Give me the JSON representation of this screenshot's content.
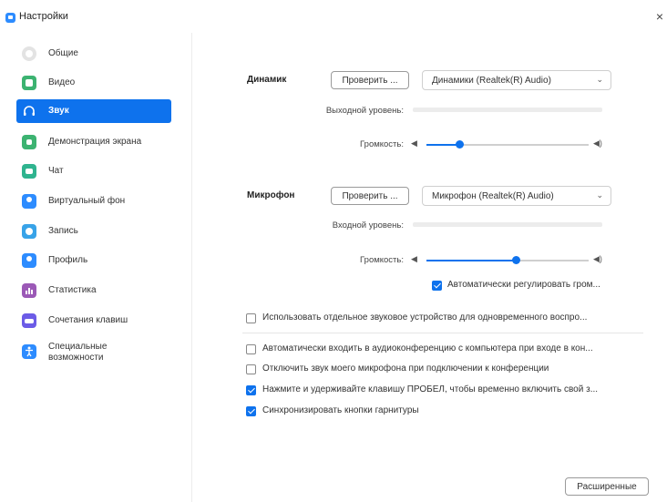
{
  "window": {
    "title": "Настройки",
    "close_glyph": "×"
  },
  "sidebar": {
    "items": [
      {
        "label": "Общие",
        "icon": "gear-icon",
        "color": "#cfcfcf"
      },
      {
        "label": "Видео",
        "icon": "video-icon",
        "color": "#3cb371"
      },
      {
        "label": "Звук",
        "icon": "headphones-icon",
        "color": "#0e72ed"
      },
      {
        "label": "Демонстрация экрана",
        "icon": "share-screen-icon",
        "color": "#3cb371"
      },
      {
        "label": "Чат",
        "icon": "chat-icon",
        "color": "#2fb48f"
      },
      {
        "label": "Виртуальный фон",
        "icon": "virtual-background-icon",
        "color": "#2d8cff"
      },
      {
        "label": "Запись",
        "icon": "record-icon",
        "color": "#38a3e8"
      },
      {
        "label": "Профиль",
        "icon": "profile-icon",
        "color": "#2d8cff"
      },
      {
        "label": "Статистика",
        "icon": "statistics-icon",
        "color": "#9b59b6"
      },
      {
        "label": "Сочетания клавиш",
        "icon": "keyboard-icon",
        "color": "#6c5ce7"
      },
      {
        "label": "Специальные возможности",
        "icon": "accessibility-icon",
        "color": "#2d8cff"
      }
    ],
    "active_index": 2
  },
  "speaker": {
    "label": "Динамик",
    "test_button": "Проверить ...",
    "device": "Динамики (Realtek(R) Audio)",
    "output_level_label": "Выходной уровень:",
    "volume_label": "Громкость:",
    "volume_percent": 20
  },
  "microphone": {
    "label": "Микрофон",
    "test_button": "Проверить ...",
    "device": "Микрофон (Realtek(R) Audio)",
    "input_level_label": "Входной уровень:",
    "volume_label": "Громкость:",
    "volume_percent": 55,
    "auto_adjust_label": "Автоматически регулировать гром...",
    "auto_adjust_checked": true
  },
  "options": [
    {
      "label": "Использовать отдельное звуковое устройство для одновременного воспро...",
      "checked": false
    },
    {
      "label": "Автоматически входить в аудиоконференцию с компьютера при входе в кон...",
      "checked": false
    },
    {
      "label": "Отключить звук моего микрофона при подключении к конференции",
      "checked": false
    },
    {
      "label": "Нажмите и удерживайте клавишу ПРОБЕЛ, чтобы временно включить свой з...",
      "checked": true
    },
    {
      "label": "Синхронизировать кнопки гарнитуры",
      "checked": true
    }
  ],
  "advanced_button": "Расширенные",
  "accent_color": "#0e72ed"
}
